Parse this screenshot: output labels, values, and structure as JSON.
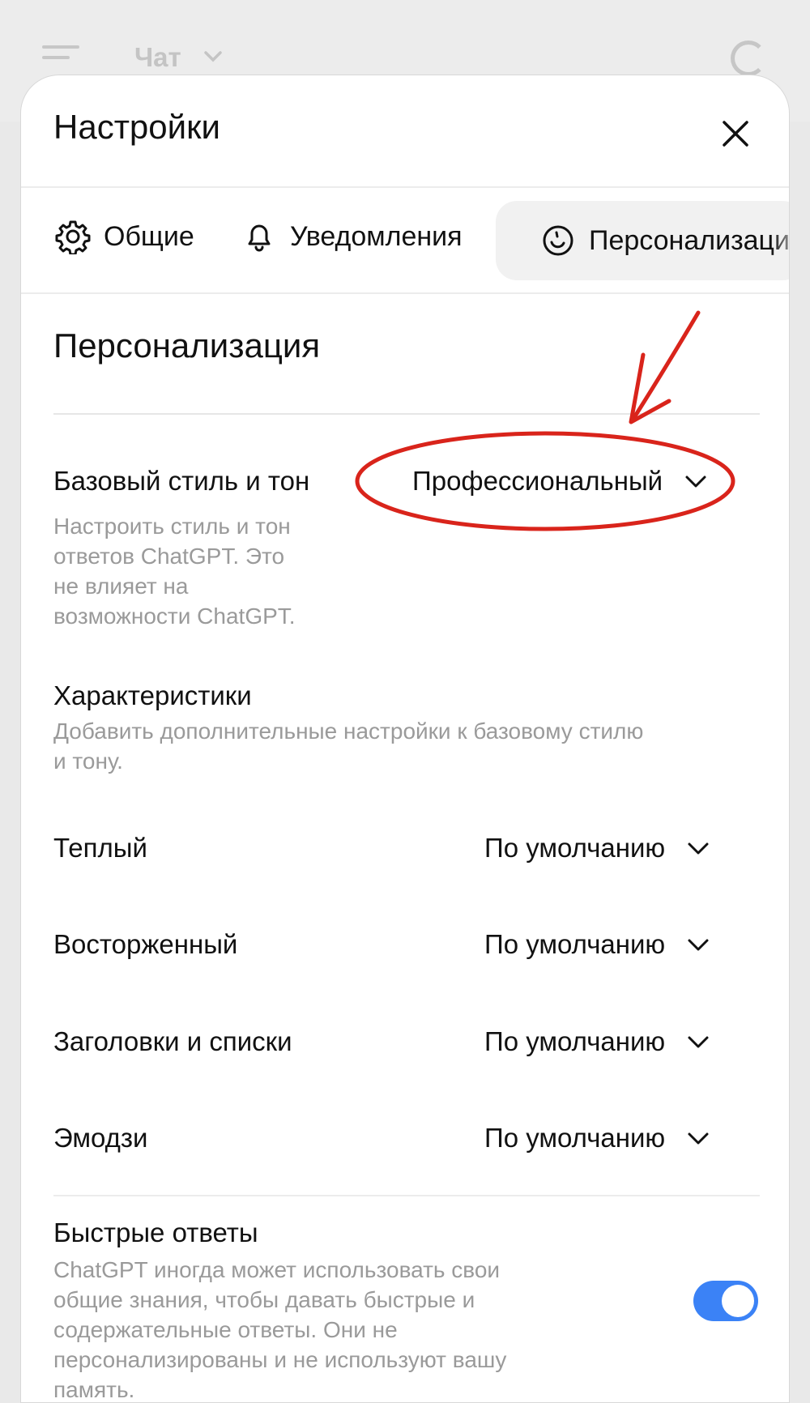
{
  "background_app": {
    "title": "Чат"
  },
  "settings": {
    "title": "Настройки",
    "tabs": [
      {
        "label": "Общие",
        "icon": "gear-icon"
      },
      {
        "label": "Уведомления",
        "icon": "bell-icon"
      },
      {
        "label": "Персонализаци",
        "icon": "personalization-icon",
        "active": true
      }
    ],
    "section_title": "Персонализация",
    "base_style": {
      "label": "Базовый стиль и тон",
      "value": "Профессиональный",
      "description": "Настроить стиль и тон ответов ChatGPT. Это не влияет на возможности ChatGPT."
    },
    "characteristics": {
      "label": "Характеристики",
      "description": "Добавить дополнительные настройки к базовому стилю и тону."
    },
    "traits": [
      {
        "label": "Теплый",
        "value": "По умолчанию"
      },
      {
        "label": "Восторженный",
        "value": "По умолчанию"
      },
      {
        "label": "Заголовки и списки",
        "value": "По умолчанию"
      },
      {
        "label": "Эмодзи",
        "value": "По умолчанию"
      }
    ],
    "quick_answers": {
      "label": "Быстрые ответы",
      "description": "ChatGPT иногда может использовать свои общие знания, чтобы давать быстрые и содержательные ответы. Они не персонализированы и не используют вашу память.",
      "enabled": true
    }
  },
  "colors": {
    "accent": "#3b82f6",
    "annotation": "#d9241b"
  }
}
